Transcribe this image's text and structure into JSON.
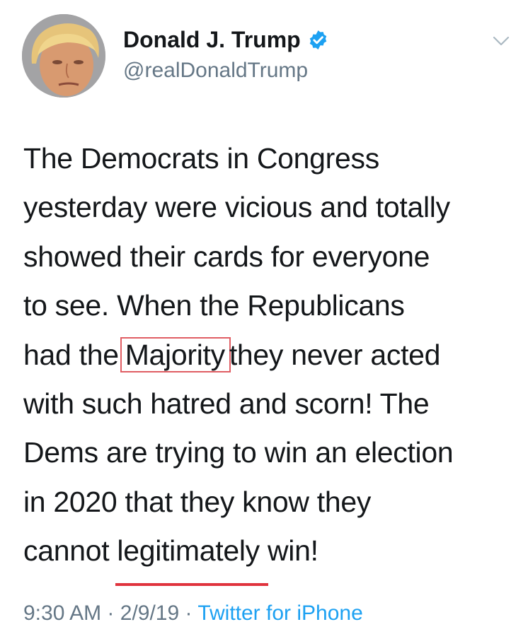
{
  "author": {
    "name": "Donald J. Trump",
    "handle": "@realDonaldTrump",
    "verified": true,
    "verified_color": "#1da1f2"
  },
  "tweet": {
    "lines": [
      "The Democrats in Congress",
      "yesterday were vicious and totally",
      "showed their cards for everyone",
      "to see. When the Republicans"
    ],
    "line5_before": "had the",
    "line5_boxed": "Majority",
    "line5_after": "they never acted",
    "lines_2": [
      "with such hatred and scorn! The",
      "Dems are trying to win an election",
      "in 2020 that they know they"
    ],
    "line9_before": "cannot ",
    "line9_underlined": "legitimately",
    "line9_after": " win!"
  },
  "meta": {
    "time": "9:30 AM",
    "date": "2/9/19",
    "separator": "·",
    "source": "Twitter for iPhone"
  },
  "colors": {
    "annotation_box": "#e05d63",
    "annotation_underline": "#e0333d",
    "link": "#1da1f2",
    "secondary_text": "#657786"
  },
  "icons": [
    "verified-badge-icon",
    "chevron-down-icon"
  ]
}
